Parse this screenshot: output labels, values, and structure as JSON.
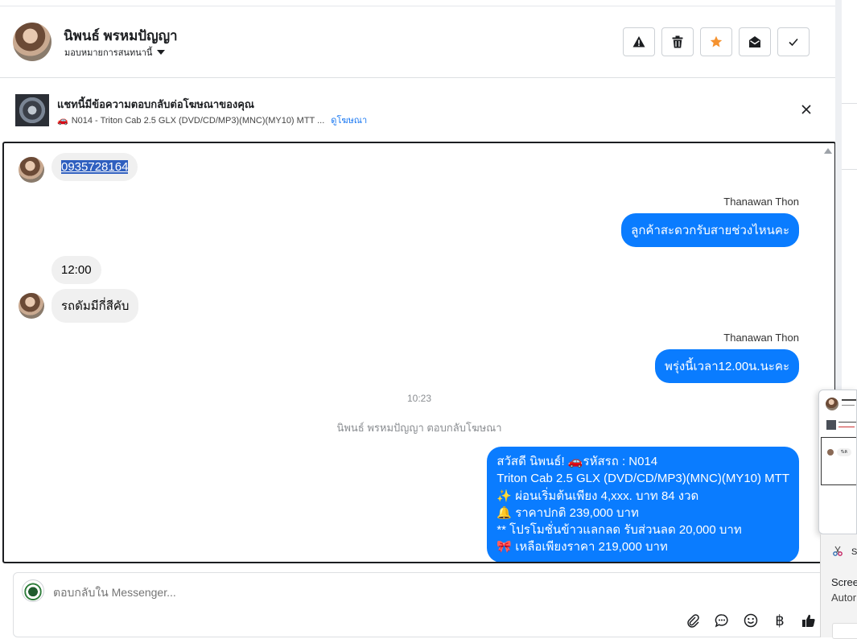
{
  "header": {
    "contact_name": "นิพนธ์ พรหมปัญญา",
    "assign_label": "มอบหมายการสนทนานี้",
    "actions": [
      {
        "name": "report",
        "icon": "warning-icon"
      },
      {
        "name": "delete",
        "icon": "trash-icon"
      },
      {
        "name": "star",
        "icon": "star-icon",
        "color": "#f5922f"
      },
      {
        "name": "mark-unread",
        "icon": "envelope-open-icon"
      },
      {
        "name": "mark-done",
        "icon": "check-icon"
      }
    ]
  },
  "ad_banner": {
    "title": "แชทนี้มีข้อความตอบกลับต่อโฆษณาของคุณ",
    "ad_name": "N014 - Triton Cab 2.5 GLX (DVD/CD/MP3)(MNC)(MY10) MTT ...",
    "view_ad_link": "ดูโฆษณา"
  },
  "messages": {
    "m1_phone": "0935728164",
    "m2_sender": "Thanawan Thon",
    "m2_text": "ลูกค้าสะดวกรับสายช่วงไหนคะ",
    "m3_text": "12:00",
    "m4_text": "รถดัมมีกี่สีคับ",
    "m5_sender": "Thanawan Thon",
    "m5_text": "พรุ่งนี้เวลา12.00น.นะคะ",
    "timestamp": "10:23",
    "ad_reply_note": "นิพนธ์ พรหมปัญญา ตอบกลับโฆษณา",
    "m6_lines": [
      "สวัสดี นิพนธ์! 🚗รหัสรถ : N014",
      "Triton Cab 2.5 GLX (DVD/CD/MP3)(MNC)(MY10) MTT",
      "✨ ผ่อนเริ่มต้นเพียง 4,xxx. บาท 84 งวด",
      "🔔 ราคาปกติ 239,000 บาท",
      "** โปรโมชั่นข้าวแลกลด รับส่วนลด 20,000 บาท",
      "🎀 เหลือเพียงราคา 219,000 บาท"
    ]
  },
  "reply_box": {
    "placeholder": "ตอบกลับใน Messenger...",
    "tools": [
      "paperclip-icon",
      "chat-bubble-icon",
      "emoji-icon",
      "baht-icon",
      "thumbs-up-icon"
    ],
    "baht_symbol": "฿"
  },
  "snipping_tool": {
    "title": "Sn",
    "line1": "Scree",
    "line2": "Autor"
  },
  "popup_preview": {
    "bubble_text": "รีเคิ"
  },
  "colors": {
    "accent": "#0a7cff",
    "star": "#f5922f"
  }
}
